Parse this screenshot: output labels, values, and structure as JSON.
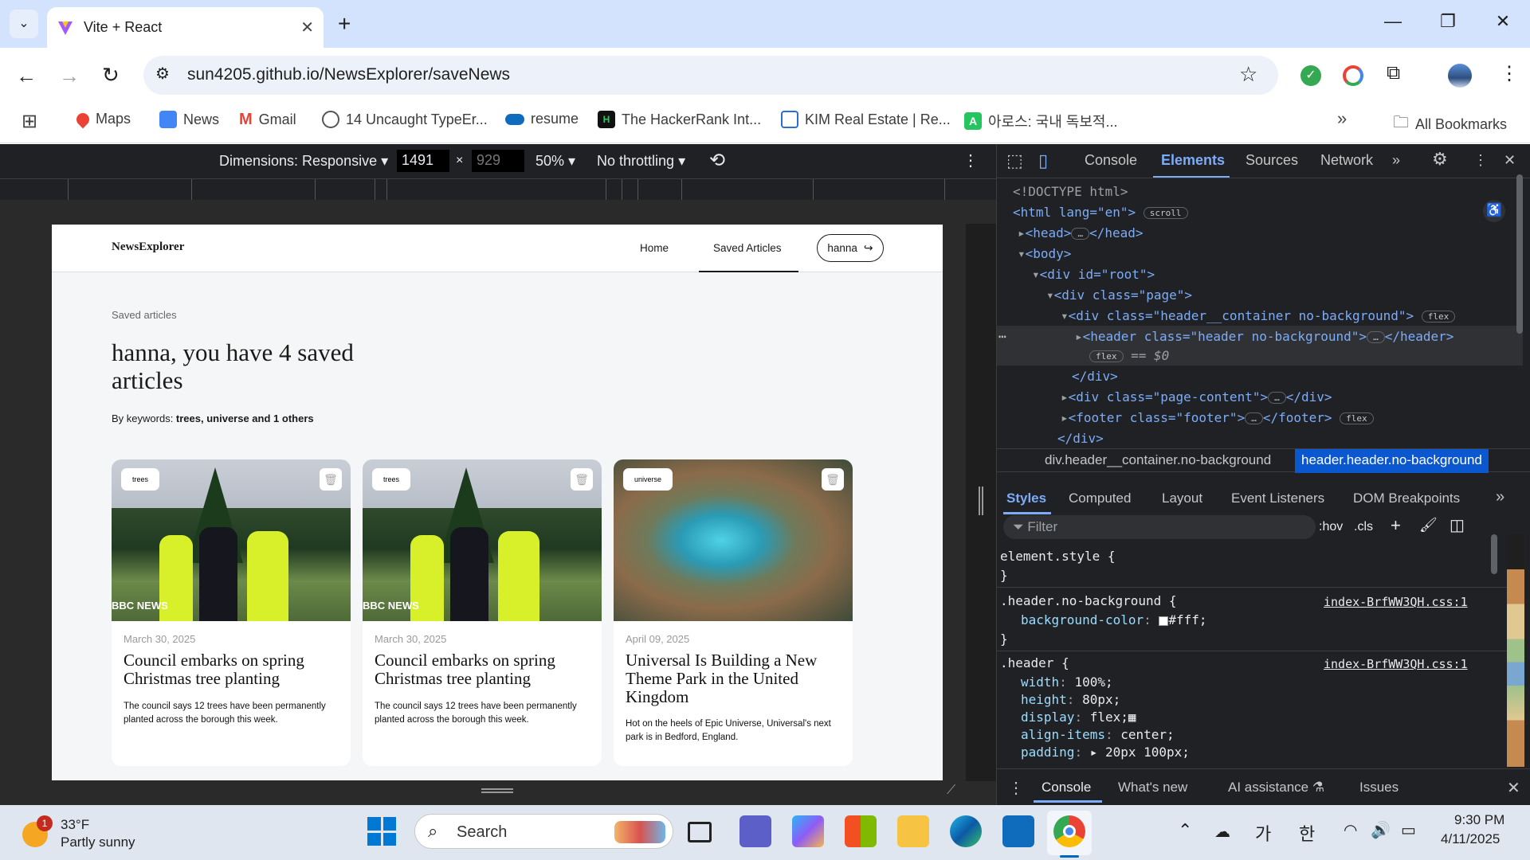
{
  "browser": {
    "tab_title": "Vite + React",
    "url": "sun4205.github.io/NewsExplorer/saveNews",
    "bookmarks": [
      "Maps",
      "News",
      "Gmail",
      "14 Uncaught TypeEr...",
      "resume",
      "The HackerRank Int...",
      "KIM Real Estate | Re...",
      "아로스: 국내 독보적...",
      "All Bookmarks"
    ]
  },
  "device_toolbar": {
    "dimensions_label": "Dimensions: Responsive",
    "width": "1491",
    "height": "929",
    "zoom": "50%",
    "throttling": "No throttling"
  },
  "site": {
    "logo": "NewsExplorer",
    "nav_home": "Home",
    "nav_saved": "Saved Articles",
    "user_button": "hanna",
    "section_label": "Saved articles",
    "heading_line1": "hanna, you have 4 saved",
    "heading_line2": "articles",
    "keywords_prefix": "By keywords: ",
    "keywords_value": "trees, universe and 1 others",
    "cards": [
      {
        "tag": "trees",
        "date": "March 30, 2025",
        "title": "Council embarks on spring Christmas tree planting",
        "text": "The council says 12 trees have been permanently planted across the borough this week.",
        "watermark": "BBC NEWS"
      },
      {
        "tag": "trees",
        "date": "March 30, 2025",
        "title": "Council embarks on spring Christmas tree planting",
        "text": "The council says 12 trees have been permanently planted across the borough this week.",
        "watermark": "BBC NEWS"
      },
      {
        "tag": "universe",
        "date": "April 09, 2025",
        "title": "Universal Is Building a New Theme Park in the United Kingdom",
        "text": "Hot on the heels of Epic Universe, Universal's next park is in Bedford, England.",
        "watermark": ""
      }
    ]
  },
  "devtools": {
    "tabs": [
      "Console",
      "Elements",
      "Sources",
      "Network"
    ],
    "active_tab": "Elements",
    "dom": {
      "doctype": "<!DOCTYPE html>",
      "html_open": "<html lang=\"en\">",
      "scroll_pill": "scroll",
      "head": "<head>",
      "head_close": "</head>",
      "body": "<body>",
      "root": "<div id=\"root\">",
      "page": "<div class=\"page\">",
      "header_container": "<div class=\"header__container no-background\">",
      "header": "<header class=\"header no-background\">",
      "header_close": "</header>",
      "flex_pill": "flex",
      "dollar0": "== $0",
      "div_close": "</div>",
      "page_content": "<div class=\"page-content\">",
      "footer": "<footer class=\"footer\">",
      "footer_close": "</footer>",
      "div_close2": "</div>"
    },
    "breadcrumb": [
      "div.header__container.no-background",
      "header.header.no-background"
    ],
    "subtabs": [
      "Styles",
      "Computed",
      "Layout",
      "Event Listeners",
      "DOM Breakpoints"
    ],
    "filter_placeholder": "Filter",
    "hov": ":hov",
    "cls": ".cls",
    "styles": {
      "element_style": "element.style {",
      "close_brace": "}",
      "rule1_selector": ".header.no-background {",
      "rule1_source": "index-BrfWW3QH.css:1",
      "rule1_prop": "background-color",
      "rule1_val": "#fff;",
      "rule2_selector": ".header {",
      "rule2_source": "index-BrfWW3QH.css:1",
      "rule2_props": [
        {
          "prop": "width",
          "val": "100%;"
        },
        {
          "prop": "height",
          "val": "80px;"
        },
        {
          "prop": "display",
          "val": "flex;"
        },
        {
          "prop": "align-items",
          "val": "center;"
        },
        {
          "prop": "padding",
          "val": "20px 100px;"
        }
      ]
    },
    "drawer_tabs": [
      "Console",
      "What's new",
      "AI assistance",
      "Issues"
    ]
  },
  "taskbar": {
    "weather_temp": "33°F",
    "weather_desc": "Partly sunny",
    "weather_badge": "1",
    "search_placeholder": "Search",
    "ime1": "가",
    "ime2": "한",
    "time": "9:30 PM",
    "date": "4/11/2025"
  }
}
